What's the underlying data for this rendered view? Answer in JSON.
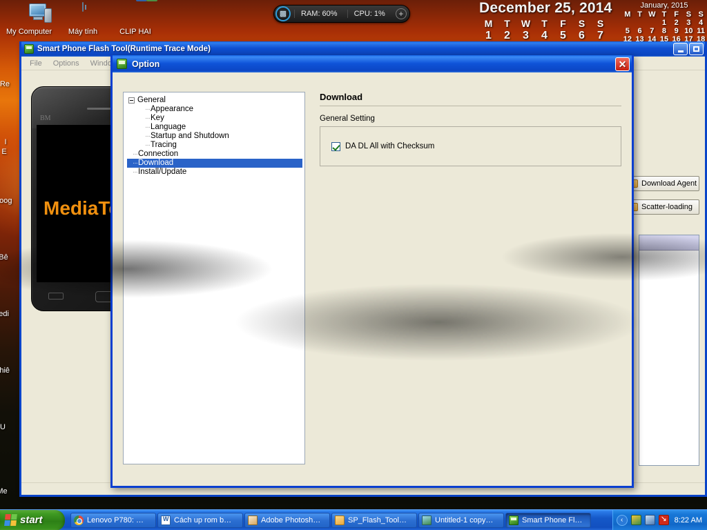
{
  "desktop": {
    "icons": [
      {
        "label": "My Computer",
        "icon": "computer-icon"
      },
      {
        "label": "Máy tính",
        "icon": "calculator-icon"
      },
      {
        "label": "CLIP HAI",
        "icon": "users-icon"
      }
    ],
    "left_column_icons": [
      {
        "label": "Re"
      },
      {
        "label": "I"
      },
      {
        "label": "E"
      },
      {
        "label": "Goog"
      },
      {
        "label": "Bê"
      },
      {
        "label": "Medi"
      },
      {
        "label": "Phiê"
      },
      {
        "label": "U"
      },
      {
        "label": "Me"
      }
    ]
  },
  "gadgets": {
    "perf": {
      "orb_icon": "cpu-chip-icon",
      "ram_label": "RAM: 60%",
      "cpu_label": "CPU: 1%",
      "add_label": "+"
    },
    "date": {
      "headline": "December 25, 2014",
      "weekday_initials": [
        "M",
        "T",
        "W",
        "T",
        "F",
        "S",
        "S"
      ],
      "week_numbers": [
        "1",
        "2",
        "3",
        "4",
        "5",
        "6",
        "7"
      ]
    },
    "month": {
      "title": "January, 2015",
      "weekday_initials": [
        "M",
        "T",
        "W",
        "T",
        "F",
        "S",
        "S"
      ],
      "weeks": [
        [
          "",
          "",
          "",
          "1",
          "2",
          "3",
          "4"
        ],
        [
          "5",
          "6",
          "7",
          "8",
          "9",
          "10",
          "11"
        ],
        [
          "12",
          "13",
          "14",
          "15",
          "16",
          "17",
          "18"
        ]
      ]
    }
  },
  "app_window": {
    "title": "Smart Phone Flash Tool(Runtime Trace Mode)",
    "title_icon": "app-icon",
    "menu": [
      "File",
      "Options",
      "Window"
    ],
    "window_buttons": {
      "minimize": "minimize-icon",
      "maximize": "maximize-icon"
    },
    "phone_art": {
      "brand_text": "MediaTek",
      "logo_text": "BM"
    },
    "side_buttons": [
      {
        "label": "Download Agent",
        "icon": "folder-icon"
      },
      {
        "label": "Scatter-loading",
        "icon": "folder-icon"
      }
    ]
  },
  "dialog": {
    "title": "Option",
    "title_icon": "app-icon",
    "close_label": "✕",
    "tree": [
      {
        "label": "General",
        "level": 0,
        "expander": true,
        "selected": false
      },
      {
        "label": "Appearance",
        "level": 1,
        "selected": false
      },
      {
        "label": "Key",
        "level": 1,
        "selected": false
      },
      {
        "label": "Language",
        "level": 1,
        "selected": false
      },
      {
        "label": "Startup and Shutdown",
        "level": 1,
        "selected": false
      },
      {
        "label": "Tracing",
        "level": 1,
        "selected": false
      },
      {
        "label": "Connection",
        "level": 0,
        "selected": false
      },
      {
        "label": "Download",
        "level": 0,
        "selected": true
      },
      {
        "label": "Install/Update",
        "level": 0,
        "selected": false
      }
    ],
    "panel": {
      "heading": "Download",
      "group_label": "General Setting",
      "checkbox": {
        "label": "DA DL All with Checksum",
        "checked": true
      }
    }
  },
  "taskbar": {
    "start_label": "start",
    "items": [
      {
        "label": "Lenovo P780: …",
        "icon": "chrome-icon",
        "active": false
      },
      {
        "label": "Cách up rom b…",
        "icon": "word-icon",
        "active": false
      },
      {
        "label": "Adobe Photosh…",
        "icon": "photoshop-icon",
        "active": false
      },
      {
        "label": "SP_Flash_Tool…",
        "icon": "folder-icon",
        "active": false
      },
      {
        "label": "Untitled-1 copy…",
        "icon": "image-icon",
        "active": false
      },
      {
        "label": "Smart Phone Fl…",
        "icon": "app-icon",
        "active": true
      }
    ],
    "tray": {
      "chevron": "‹",
      "icons": [
        "network-icon",
        "display-icon",
        "antivirus-icon"
      ],
      "clock": "8:22 AM"
    }
  }
}
